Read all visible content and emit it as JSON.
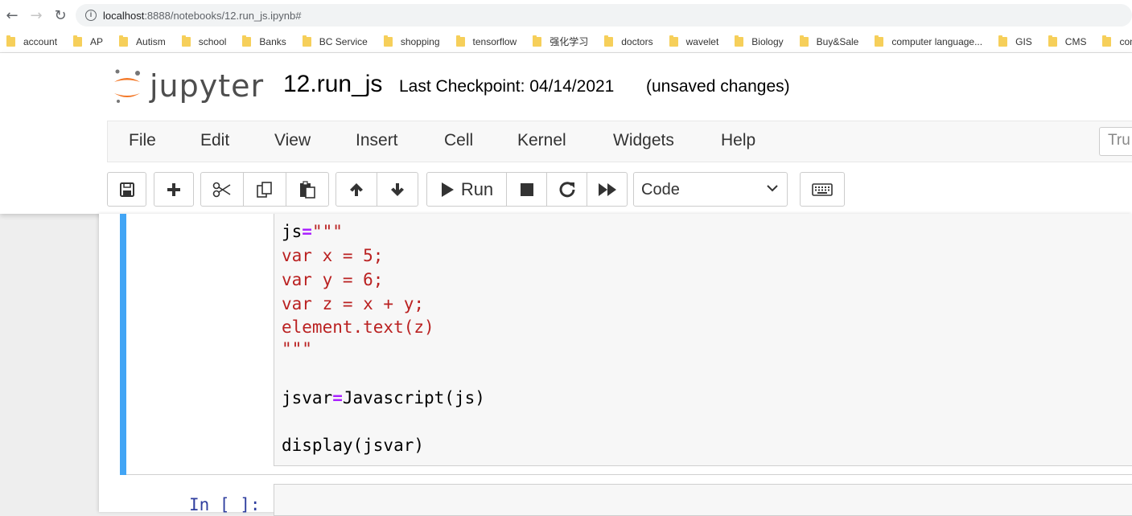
{
  "browser": {
    "url_host": "localhost",
    "url_path": ":8888/notebooks/12.run_js.ipynb#",
    "bookmarks": [
      "account",
      "AP",
      "Autism",
      "school",
      "Banks",
      "BC Service",
      "shopping",
      "tensorflow",
      "强化学习",
      "doctors",
      "wavelet",
      "Biology",
      "Buy&Sale",
      "computer language...",
      "GIS",
      "CMS",
      "compa"
    ]
  },
  "header": {
    "logo_text": "jupyter",
    "notebook_name": "12.run_js",
    "checkpoint": "Last Checkpoint: 04/14/2021",
    "status": "(unsaved changes)"
  },
  "menu": {
    "items": [
      "File",
      "Edit",
      "View",
      "Insert",
      "Cell",
      "Kernel",
      "Widgets",
      "Help"
    ],
    "trusted_label": "Tru"
  },
  "toolbar": {
    "run_label": "Run",
    "cell_type": "Code"
  },
  "cell": {
    "line1_var": "js",
    "line1_op": "=",
    "line1_str": "\"\"\"",
    "lines_str": [
      "var x = 5;",
      "var y = 6;",
      "var z = x + y;",
      "element.text(z)",
      "\"\"\""
    ],
    "line_jsvar_a": "jsvar",
    "line_jsvar_op": "=",
    "line_jsvar_b": "Javascript(js)",
    "line_display": "display(jsvar)"
  },
  "cell2": {
    "prompt": "In [ ]:"
  }
}
